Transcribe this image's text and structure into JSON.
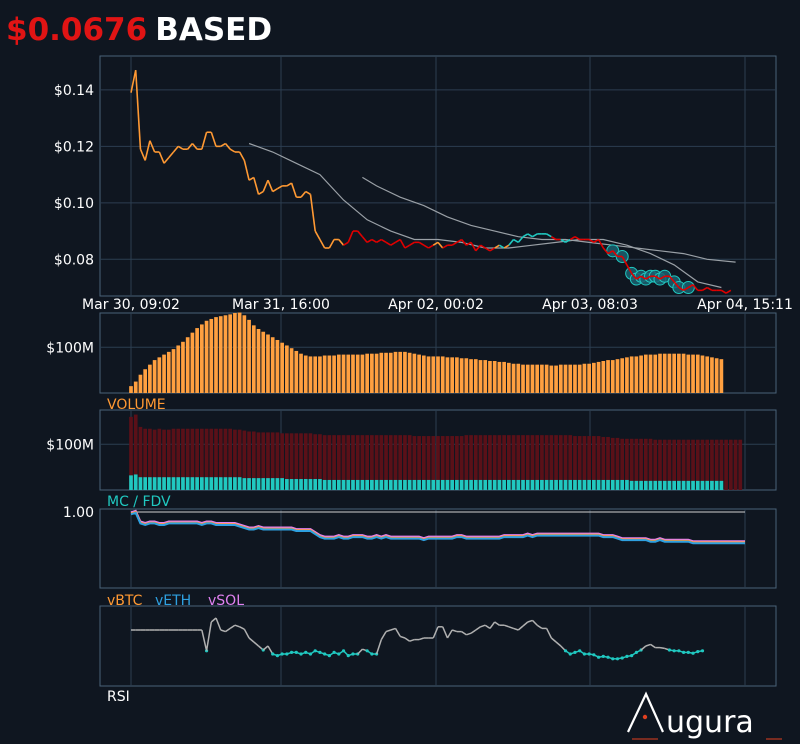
{
  "header": {
    "price": "$0.0676",
    "ticker": "BASED"
  },
  "colors": {
    "background": "#0f1620",
    "axis_border": "#4a6277",
    "grid": "#2c3e50",
    "price_up": "#ff9933",
    "price_down": "#e00000",
    "price_cyan": "#20c8c0",
    "ma_line": "#9aa0a6",
    "volume_bar": "#ffa040",
    "fdv_bar": "#5a1018",
    "mc_bar": "#20c8c0",
    "vbtc": "#ff9933",
    "veth": "#2ea0e0",
    "vsol": "#e080f0",
    "rsi_line": "#b0b0b0",
    "rsi_marker": "#20c8c0",
    "logo_dot": "#e04020"
  },
  "labels": {
    "volume": "VOLUME",
    "mcfdv": "MC / FDV",
    "vbtc": "vBTC",
    "veth": "vETH",
    "vsol": "vSOL",
    "rsi": "RSI",
    "logo": "ugura"
  },
  "chart_data": [
    {
      "type": "line",
      "name": "price",
      "x_ticks": [
        "Mar 30, 09:02",
        "Mar 31, 16:00",
        "Apr 02, 00:02",
        "Apr 03, 08:03",
        "Apr 04, 15:11"
      ],
      "y_ticks": [
        "$0.14",
        "$0.12",
        "$0.10",
        "$0.08"
      ],
      "ylim": [
        0.067,
        0.152
      ],
      "grid": true,
      "values": [
        0.139,
        0.147,
        0.119,
        0.115,
        0.122,
        0.118,
        0.118,
        0.114,
        0.116,
        0.118,
        0.12,
        0.119,
        0.119,
        0.121,
        0.119,
        0.119,
        0.125,
        0.125,
        0.12,
        0.12,
        0.121,
        0.119,
        0.118,
        0.118,
        0.115,
        0.108,
        0.109,
        0.103,
        0.104,
        0.108,
        0.104,
        0.105,
        0.106,
        0.106,
        0.107,
        0.102,
        0.102,
        0.104,
        0.103,
        0.09,
        0.087,
        0.084,
        0.084,
        0.087,
        0.087,
        0.085,
        0.086,
        0.09,
        0.09,
        0.088,
        0.086,
        0.087,
        0.086,
        0.087,
        0.086,
        0.085,
        0.086,
        0.087,
        0.084,
        0.085,
        0.086,
        0.086,
        0.085,
        0.084,
        0.085,
        0.086,
        0.084,
        0.085,
        0.085,
        0.086,
        0.087,
        0.085,
        0.086,
        0.083,
        0.085,
        0.084,
        0.083,
        0.084,
        0.085,
        0.084,
        0.085,
        0.087,
        0.086,
        0.088,
        0.089,
        0.088,
        0.089,
        0.089,
        0.089,
        0.088,
        0.087,
        0.087,
        0.086,
        0.087,
        0.088,
        0.087,
        0.087,
        0.087,
        0.086,
        0.087,
        0.084,
        0.082,
        0.083,
        0.081,
        0.081,
        0.078,
        0.075,
        0.073,
        0.074,
        0.073,
        0.074,
        0.074,
        0.073,
        0.074,
        0.074,
        0.072,
        0.07,
        0.069,
        0.07,
        0.071,
        0.069,
        0.069,
        0.07,
        0.069,
        0.069,
        0.069,
        0.068,
        0.069,
        0.068,
        0.068,
        0.067
      ],
      "segment_colors": [
        "up",
        "up",
        "up",
        "up",
        "up",
        "up",
        "up",
        "up",
        "up",
        "up",
        "up",
        "up",
        "up",
        "up",
        "up",
        "up",
        "up",
        "up",
        "up",
        "up",
        "up",
        "up",
        "up",
        "up",
        "up",
        "up",
        "up",
        "up",
        "up",
        "up",
        "up",
        "up",
        "up",
        "up",
        "up",
        "up",
        "up",
        "up",
        "up",
        "up",
        "up",
        "up",
        "up",
        "up",
        "up",
        "up",
        "down",
        "down",
        "down",
        "down",
        "down",
        "down",
        "down",
        "down",
        "down",
        "down",
        "down",
        "down",
        "down",
        "down",
        "down",
        "down",
        "down",
        "down",
        "down",
        "up",
        "up",
        "down",
        "down",
        "down",
        "down",
        "down",
        "down",
        "down",
        "down",
        "down",
        "down",
        "down",
        "up",
        "cyan",
        "up",
        "cyan",
        "cyan",
        "cyan",
        "cyan",
        "cyan",
        "cyan",
        "cyan",
        "cyan",
        "cyan",
        "down",
        "down",
        "cyan",
        "cyan",
        "down",
        "down",
        "down",
        "down",
        "down",
        "down",
        "down",
        "down",
        "down",
        "down",
        "down",
        "down",
        "down",
        "down",
        "down",
        "down",
        "down",
        "down",
        "down",
        "down",
        "down",
        "down",
        "down",
        "down",
        "down",
        "down",
        "down",
        "down",
        "down",
        "down",
        "down",
        "down",
        "down",
        "down"
      ],
      "highlight_indices": [
        102,
        104,
        106,
        107,
        108,
        109,
        110,
        111,
        112,
        113,
        115,
        116,
        118
      ],
      "ma_long": [
        [
          25,
          0.121
        ],
        [
          30,
          0.118
        ],
        [
          35,
          0.114
        ],
        [
          40,
          0.11
        ],
        [
          45,
          0.101
        ],
        [
          50,
          0.094
        ],
        [
          55,
          0.09
        ],
        [
          60,
          0.087
        ],
        [
          65,
          0.087
        ],
        [
          70,
          0.086
        ],
        [
          75,
          0.084
        ],
        [
          80,
          0.084
        ],
        [
          85,
          0.085
        ],
        [
          90,
          0.086
        ],
        [
          95,
          0.087
        ],
        [
          100,
          0.087
        ],
        [
          105,
          0.085
        ],
        [
          110,
          0.082
        ],
        [
          115,
          0.078
        ],
        [
          120,
          0.072
        ],
        [
          125,
          0.07
        ]
      ],
      "ma_short": [
        [
          49,
          0.109
        ],
        [
          52,
          0.106
        ],
        [
          57,
          0.102
        ],
        [
          62,
          0.099
        ],
        [
          67,
          0.095
        ],
        [
          72,
          0.092
        ],
        [
          77,
          0.09
        ],
        [
          82,
          0.088
        ],
        [
          87,
          0.087
        ],
        [
          92,
          0.087
        ],
        [
          97,
          0.086
        ],
        [
          102,
          0.085
        ],
        [
          107,
          0.084
        ],
        [
          112,
          0.083
        ],
        [
          117,
          0.082
        ],
        [
          122,
          0.08
        ],
        [
          128,
          0.079
        ]
      ]
    },
    {
      "type": "bar",
      "name": "volume",
      "y_ticks": [
        "$100M"
      ],
      "ylim": [
        0,
        175
      ],
      "values": [
        15,
        25,
        40,
        52,
        62,
        72,
        78,
        84,
        90,
        96,
        104,
        112,
        122,
        132,
        142,
        150,
        158,
        162,
        166,
        168,
        170,
        172,
        175,
        176,
        170,
        160,
        148,
        140,
        134,
        128,
        122,
        116,
        110,
        104,
        98,
        92,
        86,
        82,
        80,
        80,
        80,
        82,
        82,
        82,
        84,
        84,
        84,
        84,
        84,
        84,
        86,
        86,
        86,
        88,
        88,
        88,
        90,
        90,
        90,
        88,
        86,
        84,
        82,
        80,
        80,
        80,
        80,
        78,
        78,
        78,
        76,
        76,
        74,
        74,
        72,
        72,
        70,
        70,
        68,
        68,
        66,
        64,
        64,
        62,
        62,
        62,
        62,
        62,
        62,
        60,
        60,
        62,
        62,
        62,
        62,
        62,
        64,
        64,
        66,
        68,
        70,
        72,
        72,
        74,
        76,
        78,
        80,
        80,
        82,
        84,
        84,
        84,
        86,
        86,
        86,
        86,
        86,
        86,
        84,
        84,
        84,
        82,
        80,
        78,
        76,
        74
      ]
    },
    {
      "type": "bar",
      "name": "mc_fdv",
      "y_ticks": [
        "$100M"
      ],
      "ylim": [
        0,
        175
      ],
      "fdv_values": [
        160,
        165,
        138,
        134,
        134,
        132,
        134,
        132,
        132,
        134,
        134,
        134,
        134,
        134,
        134,
        134,
        134,
        134,
        134,
        134,
        134,
        134,
        132,
        132,
        130,
        128,
        128,
        126,
        126,
        126,
        126,
        126,
        124,
        124,
        124,
        124,
        124,
        124,
        124,
        122,
        122,
        120,
        120,
        120,
        120,
        120,
        120,
        120,
        120,
        120,
        120,
        120,
        120,
        120,
        120,
        120,
        120,
        120,
        120,
        120,
        118,
        118,
        118,
        118,
        118,
        118,
        118,
        118,
        118,
        118,
        118,
        120,
        120,
        120,
        120,
        120,
        120,
        120,
        120,
        120,
        120,
        120,
        120,
        120,
        120,
        120,
        120,
        120,
        120,
        120,
        120,
        120,
        120,
        120,
        118,
        118,
        118,
        118,
        118,
        118,
        116,
        116,
        114,
        114,
        112,
        112,
        112,
        112,
        112,
        112,
        112,
        110,
        110,
        110,
        110,
        110,
        110,
        110,
        110,
        110,
        110,
        110,
        110,
        110,
        110,
        110,
        110,
        110,
        110,
        110
      ],
      "mc_values": [
        32,
        34,
        28,
        28,
        28,
        28,
        28,
        28,
        28,
        28,
        28,
        28,
        28,
        28,
        28,
        28,
        28,
        28,
        28,
        28,
        28,
        28,
        28,
        28,
        26,
        26,
        26,
        26,
        26,
        26,
        26,
        26,
        26,
        24,
        24,
        24,
        24,
        24,
        24,
        24,
        24,
        22,
        22,
        22,
        22,
        22,
        22,
        22,
        22,
        22,
        22,
        22,
        22,
        22,
        22,
        22,
        22,
        22,
        22,
        22,
        22,
        22,
        22,
        22,
        22,
        22,
        22,
        22,
        22,
        22,
        22,
        22,
        22,
        22,
        22,
        22,
        22,
        22,
        22,
        22,
        22,
        22,
        22,
        22,
        22,
        22,
        22,
        22,
        22,
        22,
        22,
        22,
        22,
        22,
        22,
        22,
        22,
        22,
        22,
        22,
        22,
        22,
        22,
        22,
        22,
        22,
        20,
        20,
        20,
        20,
        20,
        20,
        20,
        20,
        20,
        20,
        20,
        20,
        20,
        20,
        20,
        20,
        20,
        20,
        20,
        20
      ]
    },
    {
      "type": "line",
      "name": "vrel",
      "y_ticks": [
        "1.00"
      ],
      "ylim": [
        0.5,
        1.02
      ],
      "reference": 1.0,
      "values": [
        0.99,
        1.0,
        0.93,
        0.92,
        0.93,
        0.93,
        0.92,
        0.92,
        0.93,
        0.93,
        0.93,
        0.93,
        0.93,
        0.93,
        0.93,
        0.92,
        0.93,
        0.93,
        0.92,
        0.92,
        0.92,
        0.92,
        0.92,
        0.91,
        0.9,
        0.89,
        0.89,
        0.9,
        0.89,
        0.89,
        0.89,
        0.89,
        0.89,
        0.89,
        0.89,
        0.88,
        0.88,
        0.88,
        0.88,
        0.86,
        0.84,
        0.83,
        0.83,
        0.83,
        0.84,
        0.83,
        0.83,
        0.84,
        0.84,
        0.84,
        0.83,
        0.83,
        0.84,
        0.83,
        0.84,
        0.83,
        0.83,
        0.83,
        0.83,
        0.83,
        0.83,
        0.83,
        0.82,
        0.83,
        0.83,
        0.83,
        0.83,
        0.83,
        0.83,
        0.84,
        0.84,
        0.83,
        0.83,
        0.83,
        0.83,
        0.83,
        0.83,
        0.83,
        0.83,
        0.84,
        0.84,
        0.84,
        0.84,
        0.84,
        0.85,
        0.84,
        0.85,
        0.85,
        0.85,
        0.85,
        0.85,
        0.85,
        0.85,
        0.85,
        0.85,
        0.85,
        0.85,
        0.85,
        0.85,
        0.85,
        0.84,
        0.84,
        0.84,
        0.83,
        0.82,
        0.82,
        0.82,
        0.82,
        0.82,
        0.82,
        0.81,
        0.81,
        0.82,
        0.81,
        0.81,
        0.81,
        0.81,
        0.81,
        0.81,
        0.8,
        0.8,
        0.8,
        0.8,
        0.8,
        0.8,
        0.8,
        0.8,
        0.8,
        0.8,
        0.8,
        0.8
      ],
      "offsets": {
        "vBTC": 0.0,
        "vETH": -0.005,
        "vSOL": 0.008
      }
    },
    {
      "type": "line",
      "name": "rsi",
      "ylim": [
        0,
        100
      ],
      "values": [
        70,
        70,
        70,
        70,
        70,
        70,
        70,
        70,
        70,
        70,
        70,
        70,
        70,
        70,
        70,
        70,
        44,
        80,
        85,
        70,
        68,
        72,
        76,
        74,
        71,
        60,
        55,
        50,
        45,
        50,
        40,
        38,
        40,
        40,
        42,
        42,
        40,
        42,
        40,
        44,
        42,
        40,
        38,
        42,
        40,
        44,
        38,
        40,
        40,
        46,
        44,
        40,
        40,
        58,
        68,
        70,
        72,
        62,
        60,
        56,
        58,
        58,
        60,
        60,
        60,
        74,
        74,
        60,
        70,
        68,
        68,
        64,
        66,
        70,
        74,
        76,
        72,
        80,
        76,
        76,
        74,
        72,
        70,
        75,
        80,
        82,
        76,
        72,
        72,
        60,
        55,
        50,
        44,
        40,
        42,
        44,
        40,
        40,
        39,
        36,
        37,
        36,
        34,
        34,
        35,
        37,
        38,
        42,
        45,
        50,
        52,
        48,
        48,
        47,
        45,
        44,
        44,
        42,
        42,
        41,
        43,
        44
      ]
    }
  ]
}
